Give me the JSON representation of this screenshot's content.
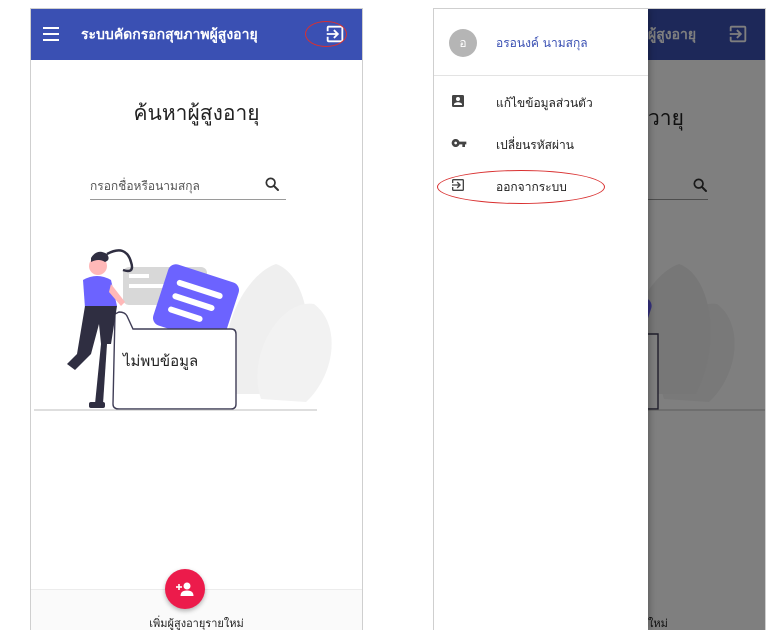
{
  "app": {
    "title": "ระบบคัดกรอกสุขภาพผู้สูงอายุ",
    "title_partial": "ผู้สูงอายุ"
  },
  "colors": {
    "primary": "#3a50b3",
    "fab": "#ec1b4b",
    "highlight": "#d93030"
  },
  "search": {
    "heading": "ค้นหาผู้สูงอายุ",
    "heading_partial": "วายุ",
    "placeholder": "กรอกชื่อหรือนามสกุล"
  },
  "empty_state": {
    "text": "ไม่พบข้อมูล"
  },
  "fab": {
    "label": "เพิ่มผู้สูงอายุรายใหม่",
    "label_partial": "ใหม่",
    "icon": "add-person-icon"
  },
  "drawer": {
    "user": {
      "initial": "อ",
      "name": "อรอนงค์ นามสกุล"
    },
    "items": [
      {
        "label": "แก้ไขข้อมูลส่วนตัว",
        "icon": "account-box-icon"
      },
      {
        "label": "เปลี่ยนรหัสผ่าน",
        "icon": "key-icon"
      },
      {
        "label": "ออกจากระบบ",
        "icon": "logout-icon"
      }
    ]
  }
}
